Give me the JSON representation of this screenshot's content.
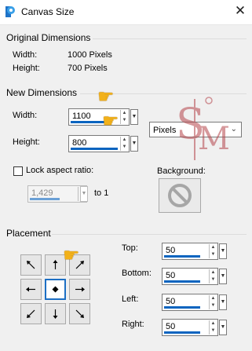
{
  "window": {
    "title": "Canvas Size",
    "close_glyph": "✕"
  },
  "original": {
    "header": "Original Dimensions",
    "width_label": "Width:",
    "width_value": "1000 Pixels",
    "height_label": "Height:",
    "height_value": "700 Pixels"
  },
  "new_dims": {
    "header": "New Dimensions",
    "width_label": "Width:",
    "width_value": "1100",
    "height_label": "Height:",
    "height_value": "800",
    "units": "Pixels",
    "lock_label": "Lock aspect ratio:",
    "ratio_value": "1,429",
    "ratio_suffix": "to 1",
    "background_label": "Background:"
  },
  "placement": {
    "header": "Placement",
    "top_label": "Top:",
    "top_value": "50",
    "bottom_label": "Bottom:",
    "bottom_value": "50",
    "left_label": "Left:",
    "left_value": "50",
    "right_label": "Right:",
    "right_value": "50",
    "selected": "center"
  },
  "colors": {
    "accent": "#0a64bf",
    "hand": "#f2b11a",
    "watermark": "#b5454b"
  },
  "icons": [
    "app-logo-icon",
    "close-icon",
    "pointing-hand-icon",
    "no-background-icon",
    "arrow-icon"
  ]
}
